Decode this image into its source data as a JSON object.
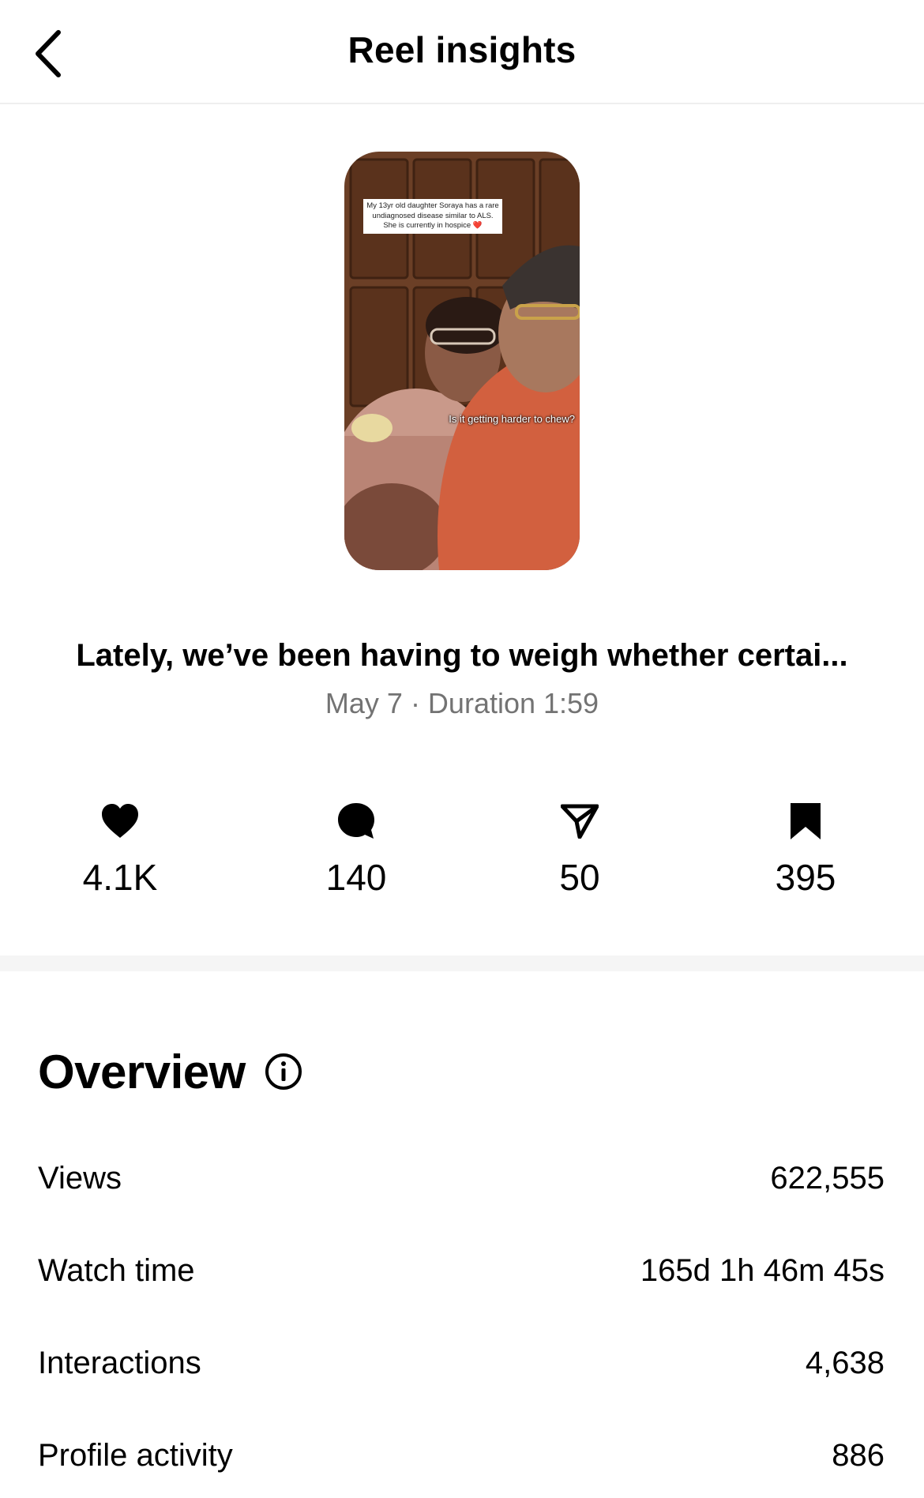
{
  "header": {
    "title": "Reel insights",
    "back_icon": "chevron-left-icon"
  },
  "reel": {
    "thumbnail_overlay_text": "My 13yr old daughter Soraya has a rare undiagnosed disease similar to ALS. She is currently in hospice ❤️",
    "thumbnail_caption": "Is it getting harder to chew?",
    "title": "Lately, we’ve been having to weigh whether certai...",
    "meta": "May 7 · Duration 1:59"
  },
  "stats": [
    {
      "icon": "heart-icon",
      "value": "4.1K"
    },
    {
      "icon": "comment-icon",
      "value": "140"
    },
    {
      "icon": "share-icon",
      "value": "50"
    },
    {
      "icon": "bookmark-icon",
      "value": "395"
    }
  ],
  "overview": {
    "title": "Overview",
    "info_icon": "info-icon",
    "rows": [
      {
        "label": "Views",
        "value": "622,555"
      },
      {
        "label": "Watch time",
        "value": "165d 1h 46m 45s"
      },
      {
        "label": "Interactions",
        "value": "4,638"
      },
      {
        "label": "Profile activity",
        "value": "886"
      }
    ]
  },
  "colors": {
    "text": "#000000",
    "secondary_text": "#737373",
    "divider": "#f5f5f5"
  }
}
